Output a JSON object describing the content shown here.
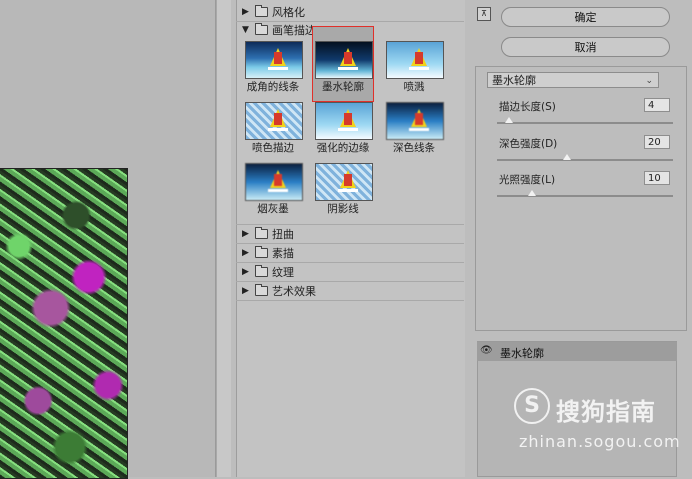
{
  "filter_categories_top": [
    {
      "label": "风格化",
      "expanded": false
    },
    {
      "label": "画笔描边",
      "expanded": true
    }
  ],
  "filters": [
    {
      "label": "成角的线条",
      "style": "normal",
      "selected": false
    },
    {
      "label": "墨水轮廓",
      "style": "dark",
      "selected": true
    },
    {
      "label": "喷溅",
      "style": "bright",
      "selected": false
    },
    {
      "label": "喷色描边",
      "style": "mesh",
      "selected": false
    },
    {
      "label": "强化的边缘",
      "style": "bright",
      "selected": false
    },
    {
      "label": "深色线条",
      "style": "blur",
      "selected": false
    },
    {
      "label": "烟灰墨",
      "style": "blur",
      "selected": false
    },
    {
      "label": "阴影线",
      "style": "mesh",
      "selected": false
    }
  ],
  "filter_categories_bottom": [
    {
      "label": "扭曲"
    },
    {
      "label": "素描"
    },
    {
      "label": "纹理"
    },
    {
      "label": "艺术效果"
    }
  ],
  "buttons": {
    "ok": "确定",
    "cancel": "取消"
  },
  "settings": {
    "selected_filter": "墨水轮廓",
    "params": [
      {
        "label": "描边长度(S)",
        "value": "4",
        "fraction": 0.07
      },
      {
        "label": "深色强度(D)",
        "value": "20",
        "fraction": 0.4
      },
      {
        "label": "光照强度(L)",
        "value": "10",
        "fraction": 0.2
      }
    ]
  },
  "effect_layers": [
    {
      "name": "墨水轮廓",
      "visible": true
    }
  ],
  "watermark": {
    "logo_letter": "S",
    "text": "搜狗指南",
    "url": "zhinan.sogou.com"
  },
  "icons": {
    "collapse": "collapse-icon",
    "eye": "eye-icon",
    "folder": "folder-icon"
  }
}
